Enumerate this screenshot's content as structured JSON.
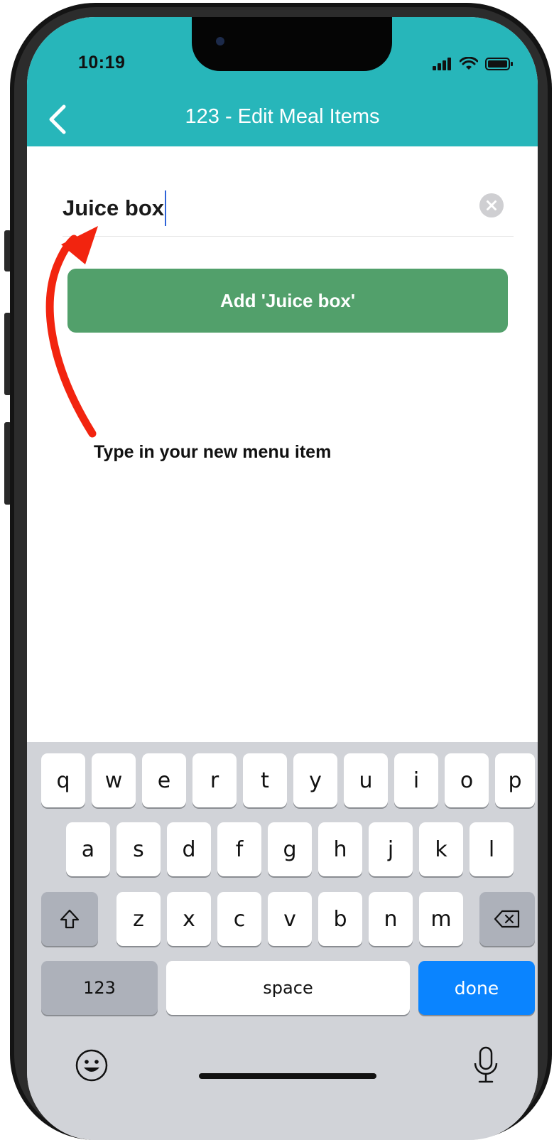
{
  "status_bar": {
    "time": "10:19"
  },
  "header": {
    "title": "123 - Edit Meal Items",
    "background": "#27b6ba"
  },
  "input": {
    "value": "Juice box"
  },
  "add_button": {
    "label": "Add 'Juice box'",
    "color": "#52a06b"
  },
  "annotation": {
    "text": "Type in your new menu item",
    "arrow_color": "#f2240f"
  },
  "keyboard": {
    "row1": [
      "q",
      "w",
      "e",
      "r",
      "t",
      "y",
      "u",
      "i",
      "o",
      "p"
    ],
    "row2": [
      "a",
      "s",
      "d",
      "f",
      "g",
      "h",
      "j",
      "k",
      "l"
    ],
    "row3": [
      "z",
      "x",
      "c",
      "v",
      "b",
      "n",
      "m"
    ],
    "numbers_label": "123",
    "space_label": "space",
    "done_label": "done",
    "done_color": "#0a84ff"
  }
}
